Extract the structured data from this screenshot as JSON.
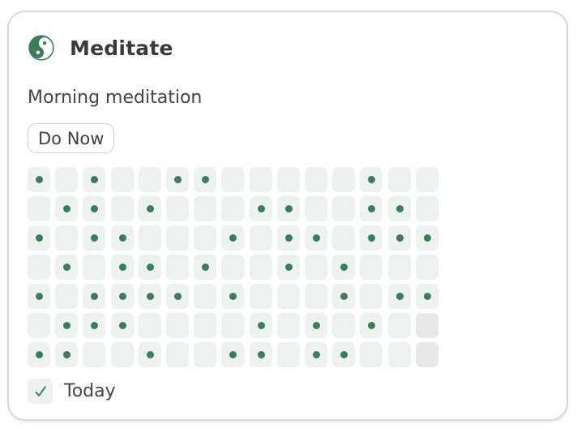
{
  "habit": {
    "title": "Meditate",
    "icon": "yin-yang-icon",
    "description": "Morning meditation",
    "do_now_label": "Do Now"
  },
  "colors": {
    "accent": "#3f7a5c",
    "cell_bg": "#edf2ee",
    "cell_future_bg": "#e7e8e7",
    "border": "#d9d9d9",
    "text": "#3a3a3a"
  },
  "history": {
    "columns": 15,
    "rows": 7,
    "grid": [
      [
        1,
        0,
        1,
        0,
        0,
        1,
        1,
        0,
        0,
        0,
        0,
        0,
        1,
        0,
        0
      ],
      [
        0,
        1,
        1,
        0,
        1,
        0,
        0,
        0,
        1,
        1,
        0,
        0,
        1,
        1,
        0
      ],
      [
        1,
        0,
        1,
        1,
        0,
        0,
        0,
        1,
        0,
        1,
        1,
        0,
        1,
        1,
        1
      ],
      [
        0,
        1,
        0,
        1,
        1,
        0,
        1,
        0,
        0,
        1,
        0,
        1,
        0,
        0,
        0
      ],
      [
        1,
        0,
        1,
        1,
        1,
        1,
        0,
        1,
        0,
        0,
        0,
        1,
        0,
        1,
        1
      ],
      [
        0,
        1,
        1,
        1,
        0,
        0,
        0,
        0,
        1,
        0,
        1,
        0,
        1,
        0,
        2
      ],
      [
        1,
        1,
        0,
        0,
        1,
        0,
        0,
        1,
        1,
        0,
        1,
        1,
        0,
        0,
        2
      ]
    ],
    "legend": {
      "done": 1,
      "not_done": 0,
      "future": 2
    }
  },
  "today": {
    "label": "Today",
    "checked": true,
    "check_icon": "checkmark-icon"
  }
}
